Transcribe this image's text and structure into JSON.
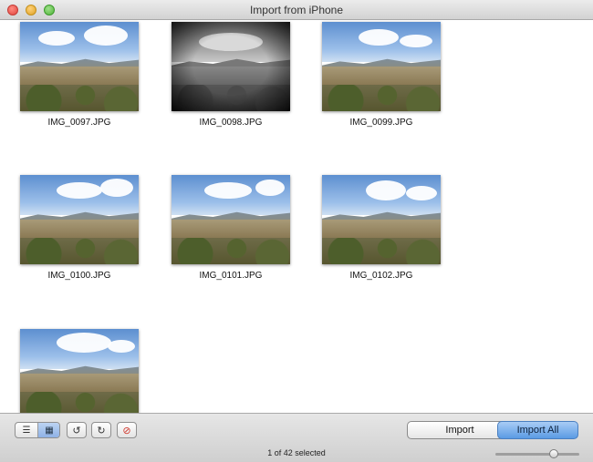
{
  "window": {
    "title": "Import from iPhone"
  },
  "photos": [
    {
      "name": "IMG_0097.JPG",
      "style": "color"
    },
    {
      "name": "IMG_0098.JPG",
      "style": "bw"
    },
    {
      "name": "IMG_0099.JPG",
      "style": "color"
    },
    {
      "name": "IMG_0100.JPG",
      "style": "color"
    },
    {
      "name": "IMG_0101.JPG",
      "style": "color"
    },
    {
      "name": "IMG_0102.JPG",
      "style": "color"
    },
    {
      "name": "",
      "style": "color"
    }
  ],
  "toolbar": {
    "list_view_icon": "list-icon",
    "grid_view_icon": "grid-icon",
    "rotate_left_icon": "rotate-left-icon",
    "rotate_right_icon": "rotate-right-icon",
    "delete_icon": "delete-icon",
    "import_label": "Import",
    "import_all_label": "Import All"
  },
  "status": {
    "selection_text": "1 of 42 selected"
  },
  "zoom": {
    "level": 0.72
  }
}
